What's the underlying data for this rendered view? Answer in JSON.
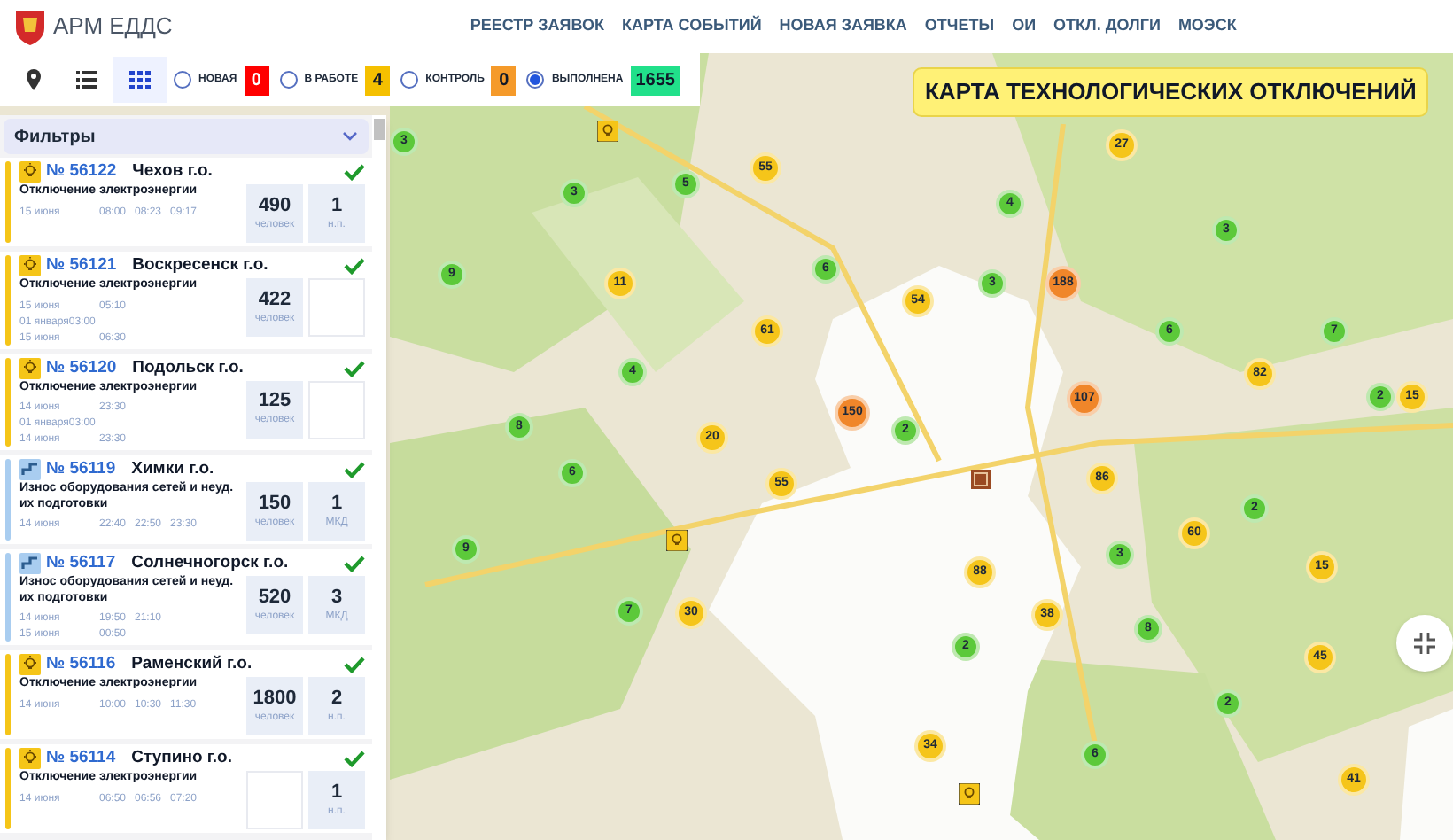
{
  "header": {
    "app_title": "АРМ ЕДДС",
    "nav": [
      {
        "label": "РЕЕСТР ЗАЯВОК"
      },
      {
        "label": "КАРТА СОБЫТИЙ"
      },
      {
        "label": "НОВАЯ ЗАЯВКА"
      },
      {
        "label": "ОТЧЕТЫ"
      },
      {
        "label": "ОИ"
      },
      {
        "label": "ОТКЛ. ДОЛГИ"
      },
      {
        "label": "МОЭСК"
      }
    ]
  },
  "view_buttons": [
    {
      "kind": "pin",
      "selected": false
    },
    {
      "kind": "list",
      "selected": false
    },
    {
      "kind": "grid",
      "selected": true
    }
  ],
  "status_filters": [
    {
      "label": "НОВАЯ",
      "count": "0",
      "color": "#ff0000",
      "selected": false
    },
    {
      "label": "В РАБОТЕ",
      "count": "4",
      "color": "#f5c000",
      "selected": false
    },
    {
      "label": "КОНТРОЛЬ",
      "count": "0",
      "color": "#f59a2a",
      "selected": false
    },
    {
      "label": "ВЫПОЛНЕНА",
      "count": "1655",
      "color": "#21e08a",
      "selected": true
    }
  ],
  "map_title": "КАРТА ТЕХНОЛОГИЧЕСКИХ ОТКЛЮЧЕНИЙ",
  "filters": {
    "title": "Фильтры"
  },
  "cards": [
    {
      "kind": "power",
      "number": "№ 56122",
      "district": "Чехов г.о.",
      "description": "Отключение электроэнергии",
      "confirmed": true,
      "time_rows": [
        [
          "15 июня",
          "08:00",
          "08:23",
          "09:17"
        ]
      ],
      "people": "490",
      "people_unit": "человек",
      "objects": "1",
      "objects_unit": "н.п."
    },
    {
      "kind": "power",
      "number": "№ 56121",
      "district": "Воскресенск г.о.",
      "description": "Отключение электроэнергии",
      "confirmed": true,
      "time_rows": [
        [
          "15 июня",
          "05:10"
        ],
        [
          "01 января03:00"
        ],
        [
          "15 июня",
          "06:30"
        ]
      ],
      "people": "422",
      "people_unit": "человек"
    },
    {
      "kind": "power",
      "number": "№ 56120",
      "district": "Подольск г.о.",
      "description": "Отключение электроэнергии",
      "confirmed": true,
      "time_rows": [
        [
          "14 июня",
          "23:30"
        ],
        [
          "01 января03:00"
        ],
        [
          "14 июня",
          "23:30"
        ]
      ],
      "people": "125",
      "people_unit": "человек"
    },
    {
      "kind": "network",
      "number": "№ 56119",
      "district": "Химки г.о.",
      "description": "Износ оборудования сетей и неуд. их подготовки",
      "confirmed": true,
      "time_rows": [
        [
          "14 июня",
          "22:40",
          "22:50",
          "23:30"
        ]
      ],
      "people": "150",
      "people_unit": "человек",
      "objects": "1",
      "objects_unit": "МКД"
    },
    {
      "kind": "network",
      "number": "№ 56117",
      "district": "Солнечногорск г.о.",
      "description": "Износ оборудования сетей и неуд. их подготовки",
      "confirmed": true,
      "time_rows": [
        [
          "14 июня",
          "19:50",
          "21:10"
        ],
        [
          "15 июня",
          "00:50"
        ]
      ],
      "people": "520",
      "people_unit": "человек",
      "objects": "3",
      "objects_unit": "МКД"
    },
    {
      "kind": "power",
      "number": "№ 56116",
      "district": "Раменский г.о.",
      "description": "Отключение электроэнергии",
      "confirmed": true,
      "time_rows": [
        [
          "14 июня",
          "10:00",
          "10:30",
          "11:30"
        ]
      ],
      "people": "1800",
      "people_unit": "человек",
      "objects": "2",
      "objects_unit": "н.п."
    },
    {
      "kind": "power",
      "number": "№ 56114",
      "district": "Ступино г.о.",
      "description": "Отключение электроэнергии",
      "confirmed": true,
      "time_rows": [
        [
          "14 июня",
          "06:50",
          "06:56",
          "07:20"
        ]
      ],
      "objects": "1",
      "objects_unit": "н.п."
    }
  ],
  "markers": [
    {
      "kind": "outage"
    },
    {
      "kind": "cluster",
      "count": "3",
      "color": "#5cc93a"
    },
    {
      "kind": "cluster",
      "count": "27",
      "color": "#f5c51a"
    },
    {
      "kind": "cluster",
      "count": "55",
      "color": "#f5c51a"
    },
    {
      "kind": "cluster",
      "count": "5",
      "color": "#5cc93a"
    },
    {
      "kind": "cluster",
      "count": "3",
      "color": "#5cc93a"
    },
    {
      "kind": "cluster",
      "count": "4",
      "color": "#5cc93a"
    },
    {
      "kind": "cluster",
      "count": "3",
      "color": "#5cc93a"
    },
    {
      "kind": "cluster",
      "count": "9",
      "color": "#5cc93a"
    },
    {
      "kind": "cluster",
      "count": "6",
      "color": "#5cc93a"
    },
    {
      "kind": "cluster",
      "count": "11",
      "color": "#f5c51a"
    },
    {
      "kind": "cluster",
      "count": "3",
      "color": "#5cc93a"
    },
    {
      "kind": "cluster",
      "count": "188",
      "color": "#f0862a"
    },
    {
      "kind": "cluster",
      "count": "54",
      "color": "#f5c51a"
    },
    {
      "kind": "cluster",
      "count": "61",
      "color": "#f5c51a"
    },
    {
      "kind": "cluster",
      "count": "6",
      "color": "#5cc93a"
    },
    {
      "kind": "cluster",
      "count": "7",
      "color": "#5cc93a"
    },
    {
      "kind": "cluster",
      "count": "4",
      "color": "#5cc93a"
    },
    {
      "kind": "cluster",
      "count": "82",
      "color": "#f5c51a"
    },
    {
      "kind": "cluster",
      "count": "107",
      "color": "#f0862a"
    },
    {
      "kind": "cluster",
      "count": "2",
      "color": "#5cc93a"
    },
    {
      "kind": "cluster",
      "count": "15",
      "color": "#f5c51a"
    },
    {
      "kind": "cluster",
      "count": "150",
      "color": "#f0862a"
    },
    {
      "kind": "cluster",
      "count": "8",
      "color": "#5cc93a"
    },
    {
      "kind": "cluster",
      "count": "2",
      "color": "#5cc93a"
    },
    {
      "kind": "cluster",
      "count": "20",
      "color": "#f5c51a"
    },
    {
      "kind": "cluster",
      "count": "6",
      "color": "#5cc93a"
    },
    {
      "kind": "cluster",
      "count": "55",
      "color": "#f5c51a"
    },
    {
      "kind": "facility"
    },
    {
      "kind": "cluster",
      "count": "86",
      "color": "#f5c51a"
    },
    {
      "kind": "cluster",
      "count": "2",
      "color": "#5cc93a"
    },
    {
      "kind": "cluster",
      "count": "60",
      "color": "#f5c51a"
    },
    {
      "kind": "cluster",
      "count": "9",
      "color": "#5cc93a"
    },
    {
      "kind": "outage"
    },
    {
      "kind": "cluster",
      "count": "3",
      "color": "#5cc93a"
    },
    {
      "kind": "cluster",
      "count": "88",
      "color": "#f5c51a"
    },
    {
      "kind": "cluster",
      "count": "15",
      "color": "#f5c51a"
    },
    {
      "kind": "cluster",
      "count": "7",
      "color": "#5cc93a"
    },
    {
      "kind": "cluster",
      "count": "30",
      "color": "#f5c51a"
    },
    {
      "kind": "cluster",
      "count": "38",
      "color": "#f5c51a"
    },
    {
      "kind": "cluster",
      "count": "8",
      "color": "#5cc93a"
    },
    {
      "kind": "cluster",
      "count": "2",
      "color": "#5cc93a"
    },
    {
      "kind": "cluster",
      "count": "45",
      "color": "#f5c51a"
    },
    {
      "kind": "cluster",
      "count": "2",
      "color": "#5cc93a"
    },
    {
      "kind": "cluster",
      "count": "34",
      "color": "#f5c51a"
    },
    {
      "kind": "cluster",
      "count": "6",
      "color": "#5cc93a"
    },
    {
      "kind": "cluster",
      "count": "41",
      "color": "#f5c51a"
    },
    {
      "kind": "outage"
    }
  ]
}
